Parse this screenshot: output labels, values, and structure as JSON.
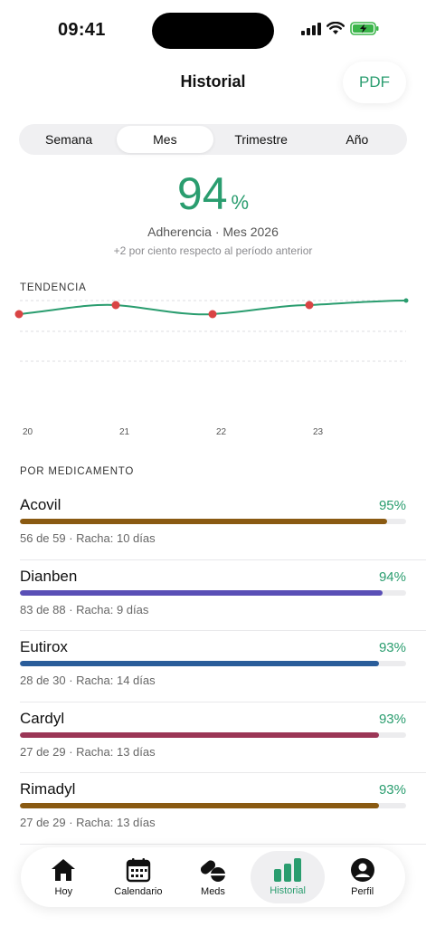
{
  "status_bar": {
    "time": "09:41"
  },
  "header": {
    "title": "Historial",
    "pdf_label": "PDF"
  },
  "segments": [
    {
      "label": "Semana",
      "active": false
    },
    {
      "label": "Mes",
      "active": true
    },
    {
      "label": "Trimestre",
      "active": false
    },
    {
      "label": "Año",
      "active": false
    }
  ],
  "summary": {
    "value": "94",
    "unit": "%",
    "label": "Adherencia · Mes 2026",
    "delta": "+2 por ciento respecto al período anterior"
  },
  "trend": {
    "section_label": "TENDENCIA",
    "x_ticks": [
      "20",
      "21",
      "22",
      "23"
    ],
    "line_color": "#2a9d6f",
    "marker_color": "#d94444"
  },
  "medications": {
    "section_label": "POR MEDICAMENTO",
    "items": [
      {
        "name": "Acovil",
        "percent": "95%",
        "fraction": 0.95,
        "meta": "56 de 59 · Racha: 10 días",
        "color": "#8a5a12"
      },
      {
        "name": "Dianben",
        "percent": "94%",
        "fraction": 0.94,
        "meta": "83 de 88 · Racha: 9 días",
        "color": "#5a4fb6"
      },
      {
        "name": "Eutirox",
        "percent": "93%",
        "fraction": 0.93,
        "meta": "28 de 30 · Racha: 14 días",
        "color": "#2a5d9a"
      },
      {
        "name": "Cardyl",
        "percent": "93%",
        "fraction": 0.93,
        "meta": "27 de 29 · Racha: 13 días",
        "color": "#9b3656"
      },
      {
        "name": "Rimadyl",
        "percent": "93%",
        "fraction": 0.93,
        "meta": "27 de 29 · Racha: 13 días",
        "color": "#8a5a12"
      }
    ]
  },
  "tabs": [
    {
      "label": "Hoy",
      "icon": "home-icon",
      "active": false
    },
    {
      "label": "Calendario",
      "icon": "calendar-icon",
      "active": false
    },
    {
      "label": "Meds",
      "icon": "pills-icon",
      "active": false
    },
    {
      "label": "Historial",
      "icon": "bar-chart-icon",
      "active": true
    },
    {
      "label": "Perfil",
      "icon": "profile-icon",
      "active": false
    }
  ],
  "colors": {
    "accent": "#2a9d6f"
  }
}
